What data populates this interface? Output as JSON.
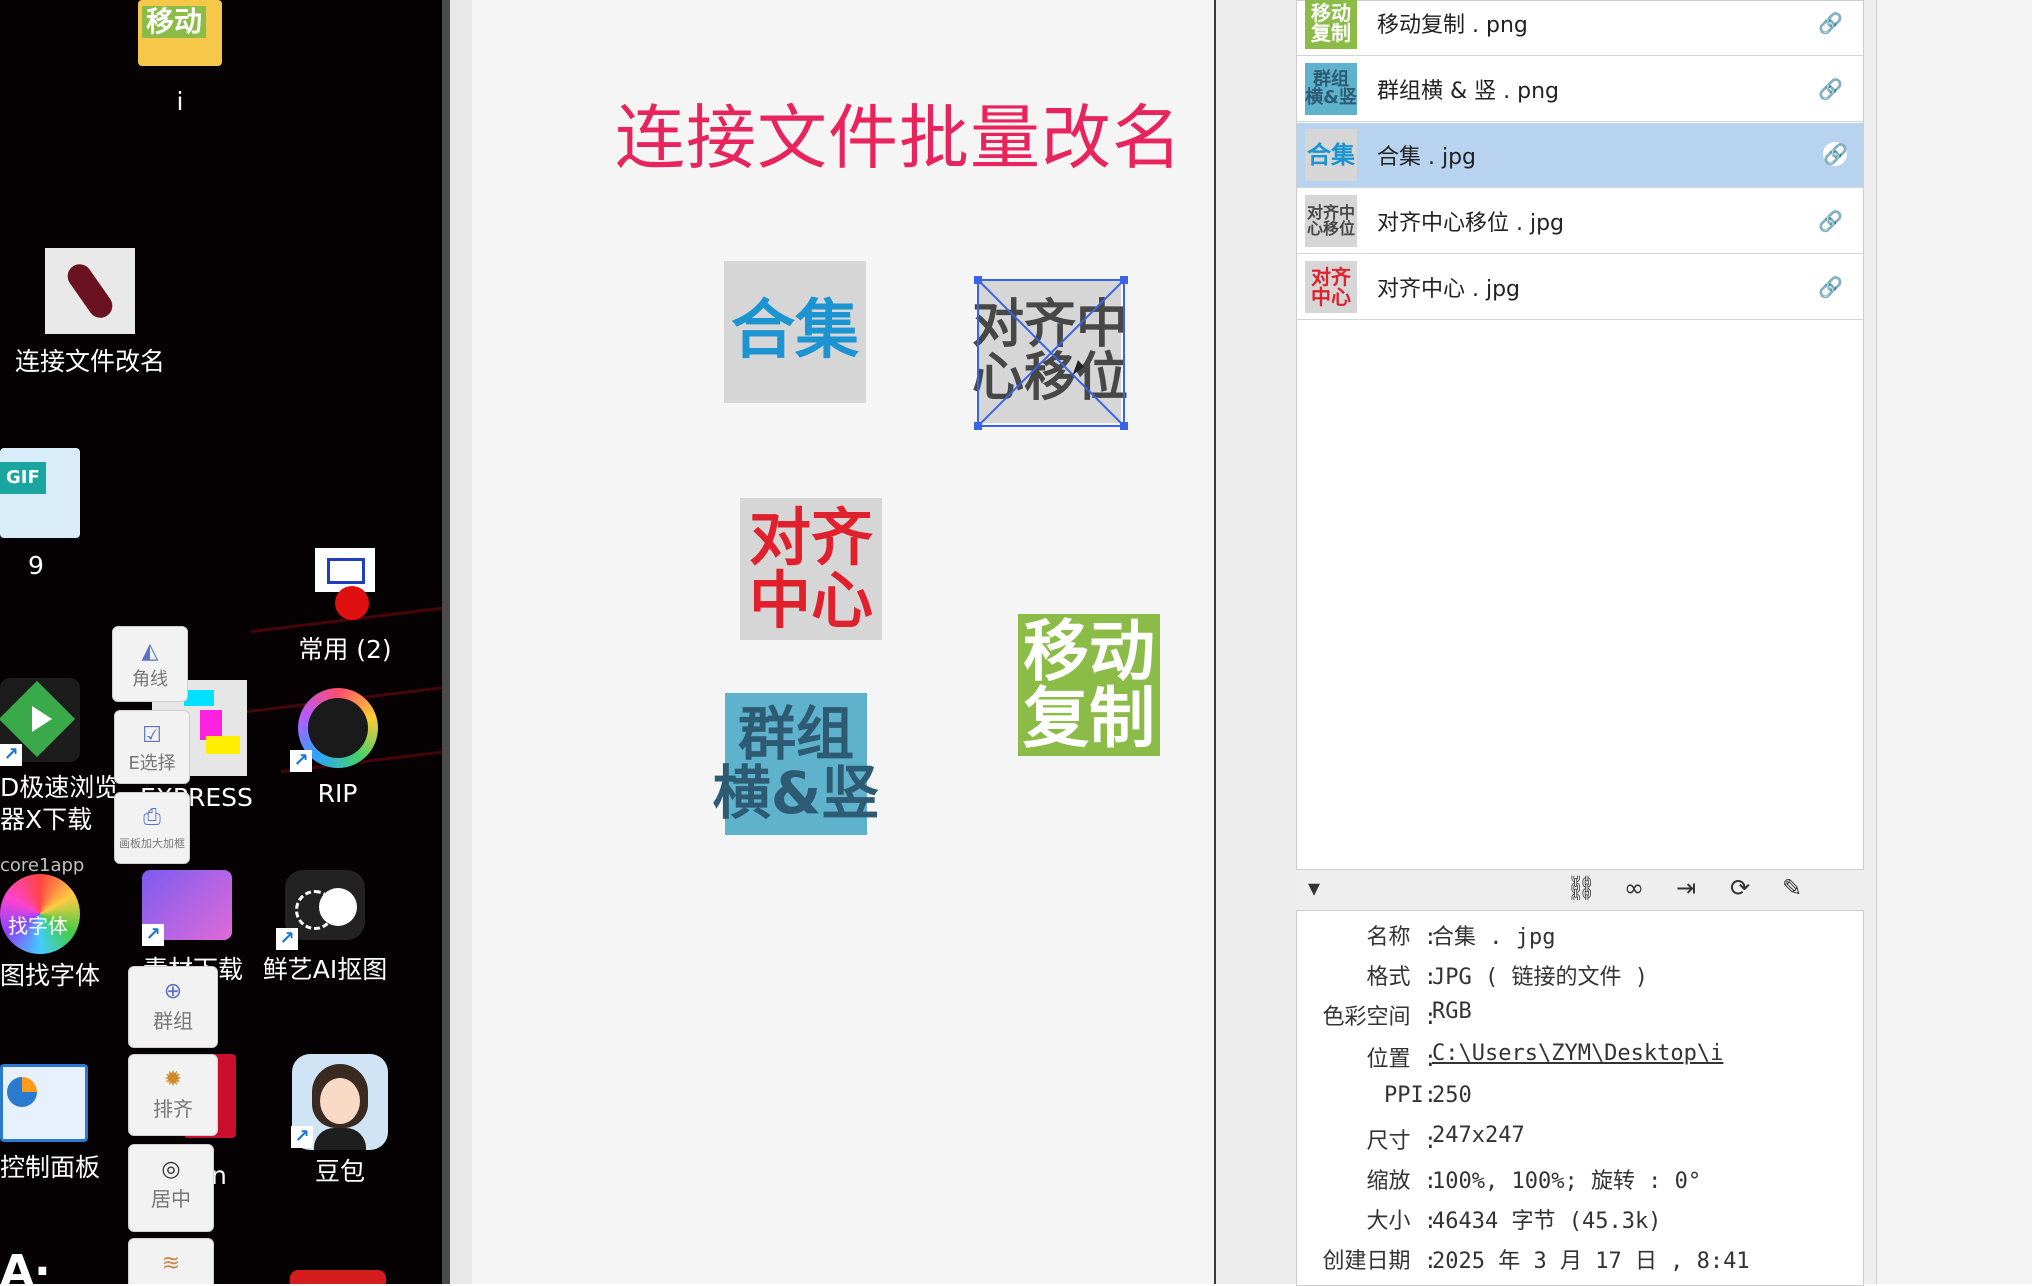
{
  "desktop": {
    "icons": [
      {
        "id": "folder-i",
        "label": "i",
        "glyph": "移动"
      },
      {
        "id": "rename",
        "label": "连接文件改名"
      },
      {
        "id": "gif",
        "label": "9",
        "glyph": "GIF"
      },
      {
        "id": "common",
        "label": "常用 (2)"
      },
      {
        "id": "browser",
        "label": "D极速浏览\n器X下载"
      },
      {
        "id": "express",
        "label": "EXPRESS"
      },
      {
        "id": "davinci",
        "label": "RIP"
      },
      {
        "id": "findfont",
        "label": "图找字体",
        "overlay": "找字体",
        "caption": "core1app"
      },
      {
        "id": "download",
        "label": "素材下载"
      },
      {
        "id": "xianyi",
        "label": "鲜艺AI抠图"
      },
      {
        "id": "control",
        "label": "控制面板"
      },
      {
        "id": "rn",
        "label": "rn"
      },
      {
        "id": "doubao",
        "label": "豆包"
      }
    ],
    "tools": [
      {
        "id": "corner",
        "label": "角线",
        "glyph": "◭"
      },
      {
        "id": "eselect",
        "label": "E选择",
        "glyph": "☑"
      },
      {
        "id": "artboard",
        "label": "画板加大加框",
        "glyph": "⎙"
      },
      {
        "id": "group",
        "label": "群组",
        "glyph": "⊕"
      },
      {
        "id": "align",
        "label": "排齐",
        "glyph": "✹"
      },
      {
        "id": "center",
        "label": "居中",
        "glyph": "◎"
      },
      {
        "id": "extra",
        "label": "",
        "glyph": "≋"
      }
    ]
  },
  "canvas": {
    "title": "连接文件批量改名",
    "tiles": [
      {
        "id": "heji",
        "text": "合集",
        "color": "#1c94d2",
        "bg": "#d6d6d6"
      },
      {
        "id": "duiqi-zhongxin-yiwei",
        "text": "对齐中\n心移位",
        "color": "#474747",
        "bg": "#d6d6d6"
      },
      {
        "id": "duiqi-zhongxin",
        "text": "对齐\n中心",
        "color": "#e0202d",
        "bg": "#d6d6d6"
      },
      {
        "id": "yidong-fuzhi",
        "text": "移动\n复制",
        "color": "#ffffff",
        "bg": "#8cbc48"
      },
      {
        "id": "qunzu",
        "text": "群组\n横&竖",
        "color": "#2e5b74",
        "bg": "#5eb2cc"
      }
    ]
  },
  "links_panel": {
    "items": [
      {
        "name": "移动复制 . png",
        "thumb": "移动\n复制",
        "thumb_fg": "#ffffff",
        "thumb_bg": "#8cbc48",
        "selected": false
      },
      {
        "name": "群组横 & 竖 . png",
        "thumb": "群组\n横&竖",
        "thumb_fg": "#2e5b74",
        "thumb_bg": "#5eb2cc",
        "selected": false
      },
      {
        "name": "合集 . jpg",
        "thumb": "合集",
        "thumb_fg": "#1c94d2",
        "thumb_bg": "#d6d6d6",
        "selected": true
      },
      {
        "name": "对齐中心移位 . jpg",
        "thumb": "对齐中\n心移位",
        "thumb_fg": "#474747",
        "thumb_bg": "#d6d6d6",
        "selected": false
      },
      {
        "name": "对齐中心 . jpg",
        "thumb": "对齐\n中心",
        "thumb_fg": "#e0202d",
        "thumb_bg": "#d6d6d6",
        "selected": false
      }
    ],
    "toolbar": [
      "expand-triangle-icon",
      "relink-to-folder-icon",
      "link-icon",
      "place-icon",
      "refresh-icon",
      "edit-pencil-icon"
    ],
    "info": {
      "name_label": "名称 :",
      "name": "合集 . jpg",
      "format_label": "格式 :",
      "format": "JPG ( 链接的文件 )",
      "colorspace_label": "色彩空间 :",
      "colorspace": "RGB",
      "location_label": "位置 :",
      "location": "C:\\Users\\ZYM\\Desktop\\i",
      "ppi_label": "PPI:",
      "ppi": "250",
      "size_label": "尺寸 :",
      "size": "247x247",
      "scale_label": "缩放 :",
      "scale": "100%, 100%; 旋转 : 0°",
      "filesize_label": "大小 :",
      "filesize": "46434 字节 (45.3k)",
      "created_label": "创建日期 :",
      "created": "2025 年 3 月 17 日 , 8:41"
    }
  }
}
